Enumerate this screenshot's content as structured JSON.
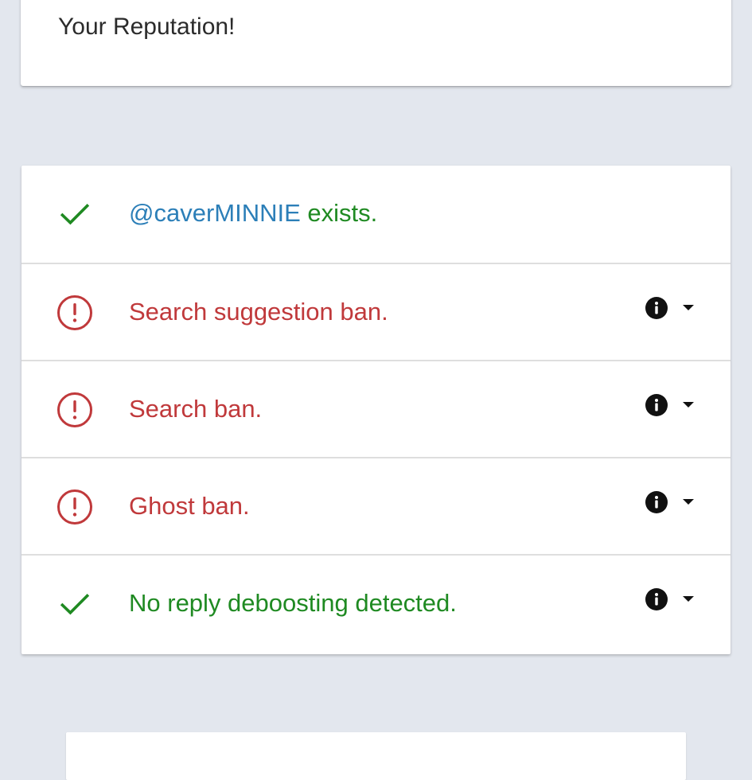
{
  "reputation_card": {
    "text": "Your Reputation!"
  },
  "results": [
    {
      "status": "ok",
      "status_icon": "check-icon",
      "handle": "@caverMINNIE",
      "label": " exists.",
      "has_details": false
    },
    {
      "status": "ban",
      "status_icon": "alert-circle-icon",
      "label": "Search suggestion ban.",
      "has_details": true,
      "details_icon": "info-icon",
      "toggle_icon": "caret-down-icon"
    },
    {
      "status": "ban",
      "status_icon": "alert-circle-icon",
      "label": "Search ban.",
      "has_details": true,
      "details_icon": "info-icon",
      "toggle_icon": "caret-down-icon"
    },
    {
      "status": "ban",
      "status_icon": "alert-circle-icon",
      "label": "Ghost ban.",
      "has_details": true,
      "details_icon": "info-icon",
      "toggle_icon": "caret-down-icon"
    },
    {
      "status": "ok",
      "status_icon": "check-icon",
      "label": "No reply deboosting detected.",
      "has_details": true,
      "details_icon": "info-icon",
      "toggle_icon": "caret-down-icon"
    }
  ],
  "colors": {
    "ok": "#1f8a22",
    "ban": "#c0393b",
    "handle": "#2c7fb8",
    "background": "#e3e7ee"
  }
}
